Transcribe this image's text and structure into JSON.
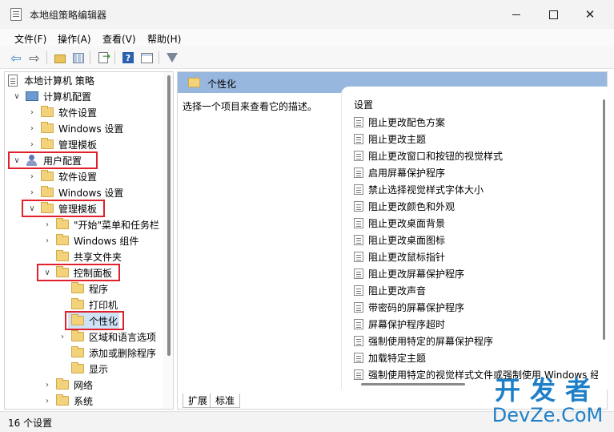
{
  "window": {
    "title": "本地组策略编辑器",
    "close_glyph": "✕"
  },
  "menu": [
    "文件(F)",
    "操作(A)",
    "查看(V)",
    "帮助(H)"
  ],
  "toolbar": {
    "icons": [
      "back-arrow-icon",
      "forward-arrow-icon",
      "folder-up-icon",
      "show-tree-icon",
      "export-list-icon",
      "help-icon",
      "console-icon",
      "filter-icon"
    ],
    "back_glyph": "⇦",
    "forward_glyph": "⇨",
    "help_glyph": "?"
  },
  "tree": {
    "root": "本地计算机 策略",
    "computer_config": "计算机配置",
    "cc_software": "软件设置",
    "cc_windows": "Windows 设置",
    "cc_admin": "管理模板",
    "user_config": "用户配置",
    "uc_software": "软件设置",
    "uc_windows": "Windows 设置",
    "uc_admin": "管理模板",
    "start_menu": "\"开始\"菜单和任务栏",
    "windows_components": "Windows 组件",
    "shared_folders": "共享文件夹",
    "control_panel": "控制面板",
    "programs": "程序",
    "printers": "打印机",
    "personalization": "个性化",
    "regional": "区域和语言选项",
    "add_remove": "添加或删除程序",
    "display": "显示",
    "network": "网络",
    "system": "系统",
    "expanded_glyph": "∨",
    "collapsed_glyph": "›"
  },
  "right": {
    "header": "个性化",
    "description": "选择一个项目来查看它的描述。",
    "list_header": "设置",
    "settings": [
      "阻止更改配色方案",
      "阻止更改主题",
      "阻止更改窗口和按钮的视觉样式",
      "启用屏幕保护程序",
      "禁止选择视觉样式字体大小",
      "阻止更改颜色和外观",
      "阻止更改桌面背景",
      "阻止更改桌面图标",
      "阻止更改鼠标指针",
      "阻止更改屏幕保护程序",
      "阻止更改声音",
      "带密码的屏幕保护程序",
      "屏幕保护程序超时",
      "强制使用特定的屏幕保护程序",
      "加载特定主题",
      "强制使用特定的视觉样式文件或强制使用 Windows 经"
    ],
    "tabs": [
      "扩展",
      "标准"
    ]
  },
  "status": "16 个设置",
  "watermark": {
    "cn": "开发者",
    "en": "DevZe.CoM"
  },
  "colors": {
    "highlight_red": "#e0202a",
    "header_blue": "#97b7de",
    "folder_yellow": "#f2d27a"
  }
}
